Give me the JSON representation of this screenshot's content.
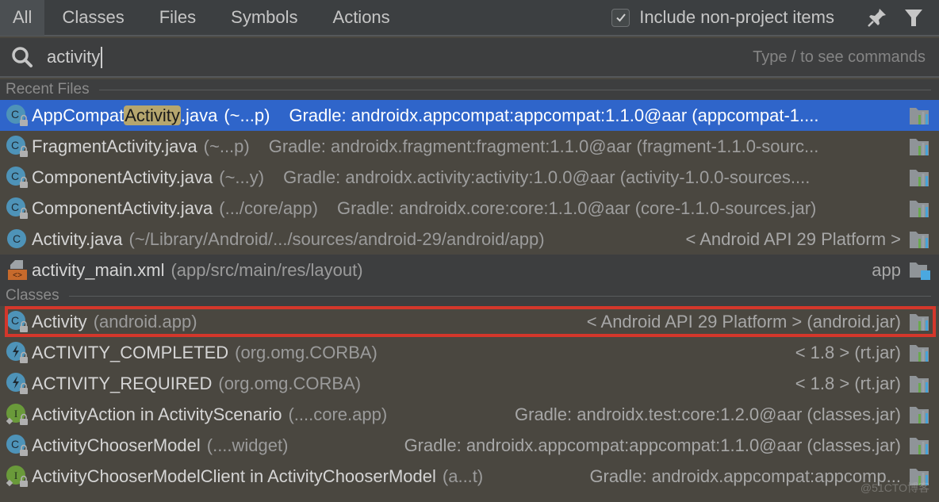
{
  "tabs": [
    {
      "label": "All",
      "active": true
    },
    {
      "label": "Classes",
      "active": false
    },
    {
      "label": "Files",
      "active": false
    },
    {
      "label": "Symbols",
      "active": false
    },
    {
      "label": "Actions",
      "active": false
    }
  ],
  "include_non_project": {
    "label": "Include non-project items",
    "checked": true
  },
  "toolbar_icons": [
    "pin-icon",
    "filter-icon"
  ],
  "search": {
    "value": "activity",
    "hint": "Type / to see commands"
  },
  "sections": {
    "recent_files": "Recent Files",
    "classes": "Classes"
  },
  "recent_files": [
    {
      "icon": "class-locked",
      "name_pre": "AppCompat",
      "name_hl": "Activity",
      "name_post": ".java",
      "loc": "(~...p)",
      "mid": "Gradle: androidx.appcompat:appcompat:1.1.0@aar (appcompat-1....",
      "right": "",
      "selected": true
    },
    {
      "icon": "class-locked",
      "name_pre": "FragmentActivity.java",
      "name_hl": "",
      "name_post": "",
      "loc": "(~...p)",
      "mid": "Gradle: androidx.fragment:fragment:1.1.0@aar (fragment-1.1.0-sourc...",
      "right": ""
    },
    {
      "icon": "class-locked",
      "name_pre": "ComponentActivity.java",
      "name_hl": "",
      "name_post": "",
      "loc": "(~...y)",
      "mid": "Gradle: androidx.activity:activity:1.0.0@aar (activity-1.0.0-sources....",
      "right": ""
    },
    {
      "icon": "class-locked",
      "name_pre": "ComponentActivity.java",
      "name_hl": "",
      "name_post": "",
      "loc": "(.../core/app)",
      "mid": "Gradle: androidx.core:core:1.1.0@aar (core-1.1.0-sources.jar)",
      "right": ""
    },
    {
      "icon": "class",
      "name_pre": "Activity.java",
      "name_hl": "",
      "name_post": "",
      "loc": "(~/Library/Android/.../sources/android-29/android/app)",
      "mid": "",
      "right": "< Android API 29 Platform >"
    },
    {
      "icon": "xml-file",
      "name_pre": "activity_main.xml",
      "name_hl": "",
      "name_post": "",
      "loc": "(app/src/main/res/layout)",
      "mid": "",
      "right": "app",
      "module": true
    }
  ],
  "classes": [
    {
      "icon": "class-locked",
      "name": "Activity",
      "loc": "(android.app)",
      "mid": "",
      "right": "< Android API 29 Platform > (android.jar)",
      "boxed": true
    },
    {
      "icon": "exception-locked",
      "name": "ACTIVITY_COMPLETED",
      "loc": "(org.omg.CORBA)",
      "mid": "",
      "right": "< 1.8 > (rt.jar)"
    },
    {
      "icon": "exception-locked",
      "name": "ACTIVITY_REQUIRED",
      "loc": "(org.omg.CORBA)",
      "mid": "",
      "right": "< 1.8 > (rt.jar)"
    },
    {
      "icon": "interface-locked",
      "name": "ActivityAction in ActivityScenario",
      "loc": "(....core.app)",
      "mid": "",
      "right": "Gradle: androidx.test:core:1.2.0@aar (classes.jar)"
    },
    {
      "icon": "class-locked",
      "name": "ActivityChooserModel",
      "loc": "(....widget)",
      "mid": "",
      "right": "Gradle: androidx.appcompat:appcompat:1.1.0@aar (classes.jar)"
    },
    {
      "icon": "interface-locked",
      "name": "ActivityChooserModelClient in ActivityChooserModel",
      "loc": "(a...t)",
      "mid": "",
      "right": "Gradle: androidx.appcompat:appcomp..."
    }
  ],
  "watermark": "@51CTO博客",
  "colors": {
    "selection": "#2f65ca",
    "highlight": "#b6a66e",
    "annotation_box": "#d4372b"
  }
}
